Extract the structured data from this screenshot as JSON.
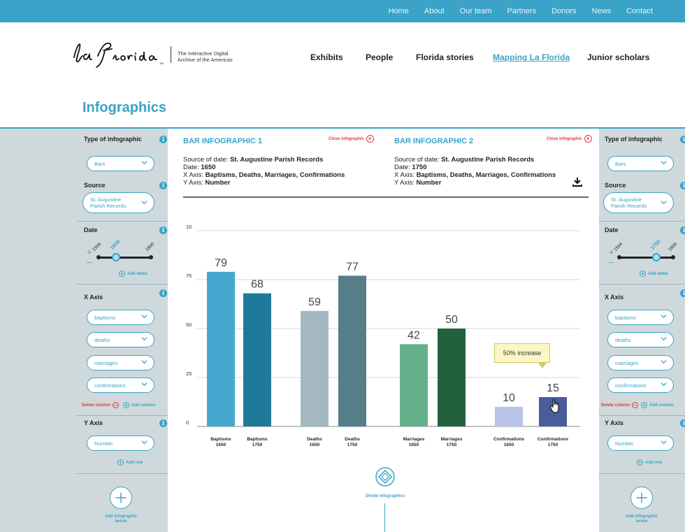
{
  "top_nav": [
    "Home",
    "About",
    "Our team",
    "Partners",
    "Donors",
    "News",
    "Contact"
  ],
  "logo": {
    "wordmark": "la Florida",
    "tagline_line1": "The Interactive Digital",
    "tagline_line2": "Archive of the Americas"
  },
  "main_nav": [
    {
      "label": "Exhibits",
      "active": false
    },
    {
      "label": "People",
      "active": false
    },
    {
      "label": "Florida stories",
      "active": false
    },
    {
      "label": "Mapping La Florida",
      "active": true
    },
    {
      "label": "Junior scholars",
      "active": false
    }
  ],
  "page_title": "Infographics",
  "left_panel": {
    "type_heading": "Type of infographic",
    "type_value": "Bars",
    "source_heading": "Source",
    "source_value_line1": "St. Augustine",
    "source_value_line2": "Parish Records",
    "date_heading": "Date",
    "date_min": "1594",
    "date_selected": "1650",
    "date_max": "1800",
    "add_dates": "Add dates",
    "x_axis_heading": "X Axis",
    "x_axis_items": [
      "baptisms",
      "deaths",
      "marriages",
      "confirmations"
    ],
    "delete_column": "Delete column",
    "add_column": "Add column",
    "y_axis_heading": "Y Axis",
    "y_axis_value": "Number",
    "add_row": "Add row",
    "add_infographic_line1": "Add infographic",
    "add_infographic_line2": "below"
  },
  "right_panel": {
    "type_heading": "Type of infographic",
    "type_value": "Bars",
    "source_heading": "Source",
    "source_value_line1": "St. Augustine",
    "source_value_line2": "Parish Records",
    "date_heading": "Date",
    "date_min": "1594",
    "date_selected": "1750",
    "date_max": "1800",
    "add_dates": "Add dates",
    "x_axis_heading": "X Axis",
    "x_axis_items": [
      "baptisms",
      "deaths",
      "marriages",
      "confirmations"
    ],
    "delete_column": "Delete column",
    "add_column": "Add column",
    "y_axis_heading": "Y Axis",
    "y_axis_value": "Number",
    "add_row": "Add row",
    "add_infographic_line1": "Add infographic",
    "add_infographic_line2": "below"
  },
  "infographic1": {
    "title": "BAR INFOGRAPHIC 1",
    "close": "Close infographic",
    "source_label": "Source of date: ",
    "source_value": "St. Augustine Parish Records",
    "date_label": "Date: ",
    "date_value": "1650",
    "xaxis_label": "X Axis: ",
    "xaxis_value": "Baptisms, Deaths, Marriages, Confirmations",
    "yaxis_label": "Y Axis: ",
    "yaxis_value": "Number"
  },
  "infographic2": {
    "title": "BAR INFOGRAPHIC 2",
    "close": "Close infographic",
    "source_label": "Source of date: ",
    "source_value": "St. Augustine Parish Records",
    "date_label": "Date: ",
    "date_value": "1750",
    "xaxis_label": "X Axis: ",
    "xaxis_value": "Baptisms, Deaths, Marriages, Confirmations",
    "yaxis_label": "Y Axis: ",
    "yaxis_value": "Number"
  },
  "callout": "50% increase",
  "divide_label": "Divide infographics",
  "chart_data": {
    "type": "bar",
    "ylim": [
      0,
      100
    ],
    "yticks": [
      0,
      25,
      50,
      75,
      10
    ],
    "grid": true,
    "bars": [
      {
        "label1": "Baptisms",
        "label2": "1650",
        "value": 79,
        "color": "#44a8cf"
      },
      {
        "label1": "Baptisms",
        "label2": "1750",
        "value": 68,
        "color": "#1f7a99"
      },
      {
        "label1": "Deaths",
        "label2": "1650",
        "value": 59,
        "color": "#a3b8c1"
      },
      {
        "label1": "Deaths",
        "label2": "1750",
        "value": 77,
        "color": "#567e88"
      },
      {
        "label1": "Marriages",
        "label2": "1650",
        "value": 42,
        "color": "#63b08a"
      },
      {
        "label1": "Marriages",
        "label2": "1750",
        "value": 50,
        "color": "#23613d"
      },
      {
        "label1": "Confirmations",
        "label2": "1650",
        "value": 10,
        "color": "#b8c4e6"
      },
      {
        "label1": "Confirmations",
        "label2": "1750",
        "value": 15,
        "color": "#4a5c9c"
      }
    ]
  }
}
